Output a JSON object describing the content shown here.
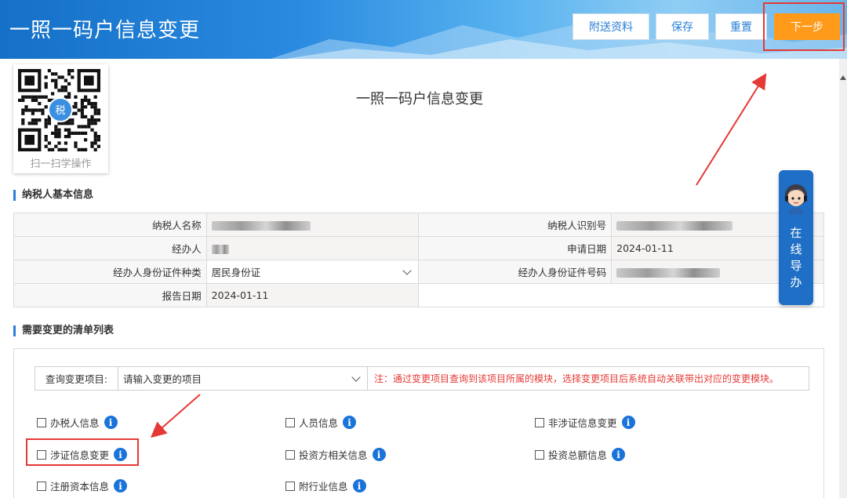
{
  "header": {
    "title": "一照一码户信息变更",
    "buttons": {
      "attach": "附送资料",
      "save": "保存",
      "reset": "重置",
      "next": "下一步"
    }
  },
  "qr": {
    "caption": "扫一扫学操作",
    "badge": "税"
  },
  "form_title": "一照一码户信息变更",
  "section_basic": "纳税人基本信息",
  "basic": {
    "taxpayer_name_label": "纳税人名称",
    "taxpayer_id_label": "纳税人识别号",
    "handler_label": "经办人",
    "apply_date_label": "申请日期",
    "apply_date_value": "2024-01-11",
    "id_type_label": "经办人身份证件种类",
    "id_type_value": "居民身份证",
    "id_number_label": "经办人身份证件号码",
    "report_date_label": "报告日期",
    "report_date_value": "2024-01-11"
  },
  "section_list": "需要变更的清单列表",
  "query": {
    "label": "查询变更项目:",
    "placeholder": "请输入变更的项目",
    "note": "注：通过变更项目查询到该项目所属的模块，选择变更项目后系统自动关联带出对应的变更模块。"
  },
  "items": [
    "办税人信息",
    "人员信息",
    "非涉证信息变更",
    "涉证信息变更",
    "投资方相关信息",
    "投资总额信息",
    "注册资本信息",
    "附行业信息"
  ],
  "guide": {
    "line1": "在",
    "line2": "线",
    "line3": "导",
    "line4": "办"
  },
  "colors": {
    "primary": "#1a73d9",
    "next_button": "#ff9a1a",
    "highlight": "#e53935"
  }
}
